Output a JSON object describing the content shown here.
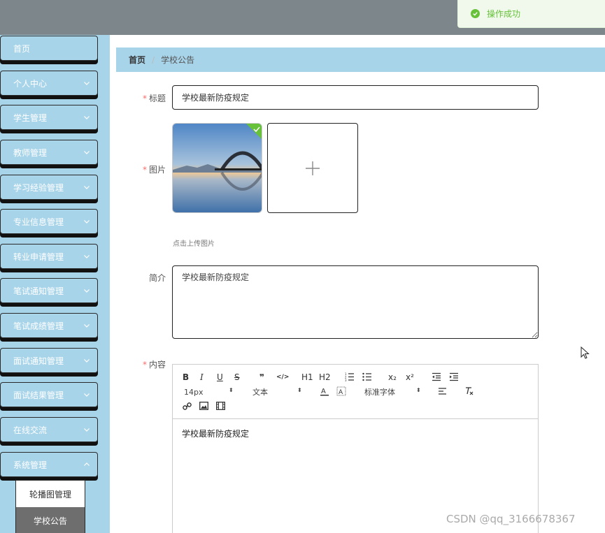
{
  "toast": {
    "message": "操作成功",
    "icon": "check-circle-icon",
    "color": "#67c23a"
  },
  "sidebar": {
    "bg": "#a8d4ea",
    "items": [
      {
        "label": "首页",
        "has_arrow": false
      },
      {
        "label": "个人中心",
        "has_arrow": true
      },
      {
        "label": "学生管理",
        "has_arrow": true
      },
      {
        "label": "教师管理",
        "has_arrow": true
      },
      {
        "label": "学习经验管理",
        "has_arrow": true
      },
      {
        "label": "专业信息管理",
        "has_arrow": true
      },
      {
        "label": "转业申请管理",
        "has_arrow": true
      },
      {
        "label": "笔试通知管理",
        "has_arrow": true
      },
      {
        "label": "笔试成绩管理",
        "has_arrow": true
      },
      {
        "label": "面试通知管理",
        "has_arrow": true
      },
      {
        "label": "面试结果管理",
        "has_arrow": true
      },
      {
        "label": "在线交流",
        "has_arrow": true
      },
      {
        "label": "系统管理",
        "has_arrow": true,
        "expanded": true
      }
    ],
    "submenu": [
      {
        "label": "轮播图管理",
        "active": false
      },
      {
        "label": "学校公告",
        "active": true
      }
    ]
  },
  "breadcrumb": {
    "home": "首页",
    "separator": "/",
    "current": "学校公告"
  },
  "form": {
    "title_label": "标题",
    "title_value": "学校最新防疫规定",
    "image_label": "图片",
    "upload_hint": "点击上传图片",
    "summary_label": "简介",
    "summary_value": "学校最新防疫规定",
    "content_label": "内容",
    "required_mark": "*"
  },
  "editor": {
    "buttons": {
      "bold": "B",
      "italic": "I",
      "underline": "U",
      "strike": "S",
      "quote": "❞",
      "code": "</>",
      "h1": "H1",
      "h2": "H2",
      "subscript": "x₂",
      "superscript": "x²"
    },
    "font_size": "14px",
    "text_style": "文本",
    "font_family": "标准字体",
    "content": "学校最新防疫规定"
  },
  "watermark": "CSDN @qq_3166678367"
}
